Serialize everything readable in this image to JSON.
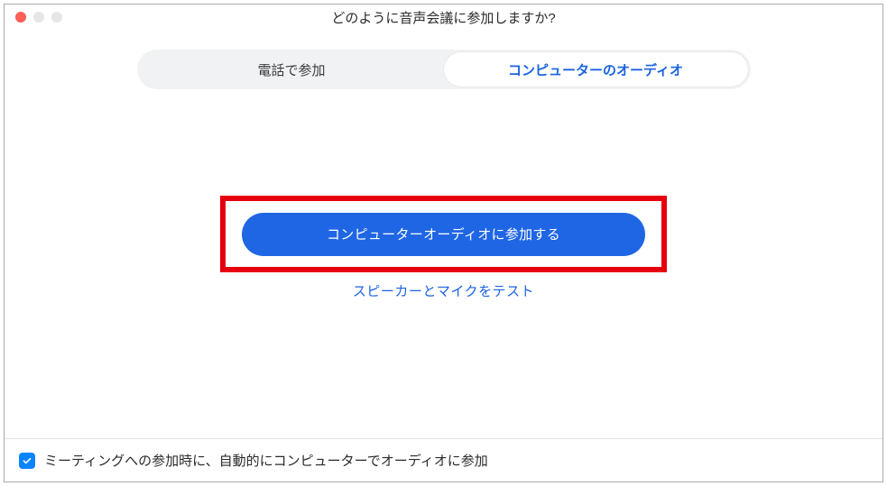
{
  "window": {
    "title": "どのように音声会議に参加しますか?"
  },
  "tabs": {
    "phone": "電話で参加",
    "computer": "コンピューターのオーディオ"
  },
  "main": {
    "join_button_label": "コンピューターオーディオに参加する",
    "test_link_label": "スピーカーとマイクをテスト"
  },
  "footer": {
    "auto_join_label": "ミーティングへの参加時に、自動的にコンピューターでオーディオに参加",
    "auto_join_checked": true
  },
  "colors": {
    "accent": "#1b63e0",
    "button": "#1f66e5",
    "highlight": "#e6000d",
    "checkbox": "#0a84ff"
  }
}
